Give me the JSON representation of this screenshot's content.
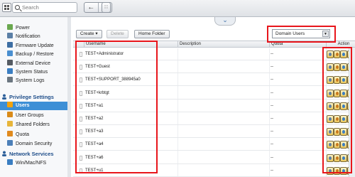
{
  "topbar": {
    "search_placeholder": "Search",
    "back_glyph": "←",
    "forward_glyph": "→",
    "grid_glyph": "∷",
    "collapse_glyph": "⌄"
  },
  "sidebar": {
    "items_top": [
      {
        "label": "Power",
        "icon": "power-icon",
        "color": "#6aa84f"
      },
      {
        "label": "Notification",
        "icon": "notification-icon",
        "color": "#5b7fa6"
      },
      {
        "label": "Firmware Update",
        "icon": "firmware-icon",
        "color": "#3d6ea3"
      },
      {
        "label": "Backup / Restore",
        "icon": "backup-icon",
        "color": "#4a8fd0"
      },
      {
        "label": "External Device",
        "icon": "external-device-icon",
        "color": "#555b63"
      },
      {
        "label": "System Status",
        "icon": "system-status-icon",
        "color": "#3a7ec2"
      },
      {
        "label": "System Logs",
        "icon": "system-logs-icon",
        "color": "#6b7680"
      }
    ],
    "section_privilege": "Privilege Settings",
    "items_privilege": [
      {
        "label": "Users",
        "icon": "users-icon",
        "color": "#f2a20c",
        "active": true
      },
      {
        "label": "User Groups",
        "icon": "user-groups-icon",
        "color": "#d98b1a"
      },
      {
        "label": "Shared Folders",
        "icon": "shared-folders-icon",
        "color": "#e7b53b"
      },
      {
        "label": "Quota",
        "icon": "quota-icon",
        "color": "#e08a1e"
      },
      {
        "label": "Domain Security",
        "icon": "domain-security-icon",
        "color": "#4c7fb8"
      }
    ],
    "section_network": "Network Services",
    "items_network": [
      {
        "label": "Win/Mac/NFS",
        "icon": "win-mac-nfs-icon",
        "color": "#3a7ec2"
      }
    ]
  },
  "toolbar": {
    "create_label": "Create ▾",
    "delete_label": "Delete",
    "home_folder_label": "Home Folder"
  },
  "filter": {
    "selected": "Domain Users",
    "arrow": "▼"
  },
  "table": {
    "headers": {
      "username": "Username",
      "description": "Description",
      "quota": "Quota",
      "action": "Action"
    },
    "rows": [
      {
        "username": "TEST+Administrator",
        "description": "",
        "quota": "--"
      },
      {
        "username": "TEST+Guest",
        "description": "",
        "quota": "--"
      },
      {
        "username": "TEST+SUPPORT_388945a0",
        "description": "",
        "quota": "--"
      },
      {
        "username": "TEST+krbtgt",
        "description": "",
        "quota": "--"
      },
      {
        "username": "TEST+a1",
        "description": "",
        "quota": "--"
      },
      {
        "username": "TEST+a2",
        "description": "",
        "quota": "--"
      },
      {
        "username": "TEST+a3",
        "description": "",
        "quota": "--"
      },
      {
        "username": "TEST+a4",
        "description": "",
        "quota": "--"
      },
      {
        "username": "TEST+a6",
        "description": "",
        "quota": "--"
      },
      {
        "username": "TEST+u1",
        "description": "",
        "quota": "--"
      }
    ],
    "action_icons": [
      "change-password-icon",
      "edit-profile-icon",
      "edit-group-icon",
      "edit-folder-permission-icon"
    ],
    "action_colors": [
      "#5b7fa6",
      "#c97a1e",
      "#3a7ec2",
      "#6aa84f"
    ]
  },
  "highlight_color": "#e8151b"
}
